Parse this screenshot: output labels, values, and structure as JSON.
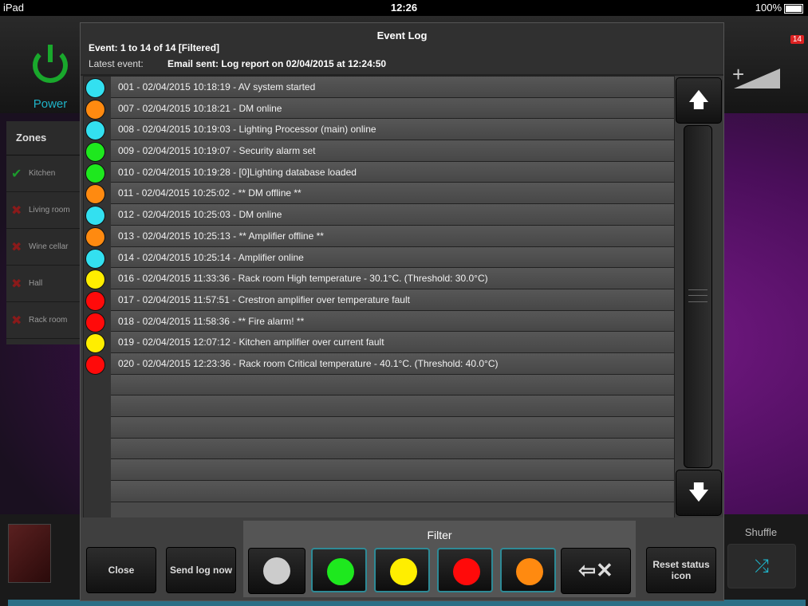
{
  "status_bar": {
    "device": "iPad",
    "time": "12:26",
    "battery": "100%"
  },
  "background": {
    "power_label": "Power",
    "alert_count": "14",
    "zones_header": "Zones",
    "zones": [
      {
        "name": "Kitchen",
        "status": "ok"
      },
      {
        "name": "Living room",
        "status": "off"
      },
      {
        "name": "Wine cellar",
        "status": "off"
      },
      {
        "name": "Hall",
        "status": "off"
      },
      {
        "name": "Rack room",
        "status": "off"
      }
    ],
    "shuffle_label": "Shuffle"
  },
  "dialog": {
    "title": "Event Log",
    "count": "Event: 1 to 14 of 14 [Filtered]",
    "latest_label": "Latest event:",
    "latest_value": "Email sent: Log report on 02/04/2015 at 12:24:50",
    "events": [
      {
        "text": "001 - 02/04/2015 10:18:19 - AV system started",
        "color": "#33e0f0"
      },
      {
        "text": "007 - 02/04/2015 10:18:21 - DM online",
        "color": "#ff8a10"
      },
      {
        "text": "008 - 02/04/2015 10:19:03 - Lighting Processor (main) online",
        "color": "#33e0f0"
      },
      {
        "text": "009 - 02/04/2015 10:19:07 - Security alarm set",
        "color": "#1ee81e"
      },
      {
        "text": "010 - 02/04/2015 10:19:28 - [0]Lighting database loaded",
        "color": "#1ee81e"
      },
      {
        "text": "011 - 02/04/2015 10:25:02 - ** DM offline **",
        "color": "#ff8a10"
      },
      {
        "text": "012 - 02/04/2015 10:25:03 - DM online",
        "color": "#33e0f0"
      },
      {
        "text": "013 - 02/04/2015 10:25:13 - ** Amplifier offline **",
        "color": "#ff8a10"
      },
      {
        "text": "014 - 02/04/2015 10:25:14 - Amplifier online",
        "color": "#33e0f0"
      },
      {
        "text": "016 - 02/04/2015 11:33:36 - Rack room High temperature - 30.1°C. (Threshold: 30.0°C)",
        "color": "#ffee00"
      },
      {
        "text": "017 - 02/04/2015 11:57:51 - Crestron amplifier over temperature fault",
        "color": "#ff0a0a"
      },
      {
        "text": "018 - 02/04/2015 11:58:36 - ** Fire alarm! **",
        "color": "#ff0a0a"
      },
      {
        "text": "019 - 02/04/2015 12:07:12 - Kitchen amplifier over current fault",
        "color": "#ffee00"
      },
      {
        "text": "020 - 02/04/2015 12:23:36 - Rack room Critical temperature - 40.1°C. (Threshold: 40.0°C)",
        "color": "#ff0a0a"
      }
    ],
    "empty_rows": 6,
    "scroll_up_icon": "arrow-up-icon",
    "scroll_down_icon": "arrow-down-icon",
    "close_label": "Close",
    "send_log_label": "Send log now",
    "filter_title": "Filter",
    "filters": [
      {
        "color_name": "grey",
        "color": "#cccccc",
        "active": false
      },
      {
        "color_name": "green",
        "color": "#1ee81e",
        "active": true
      },
      {
        "color_name": "yellow",
        "color": "#ffee00",
        "active": true
      },
      {
        "color_name": "red",
        "color": "#ff0a0a",
        "active": true
      },
      {
        "color_name": "orange",
        "color": "#ff8a10",
        "active": true
      }
    ],
    "clear_filter_icon": "clear-filter-icon",
    "reset_label": "Reset status icon"
  }
}
